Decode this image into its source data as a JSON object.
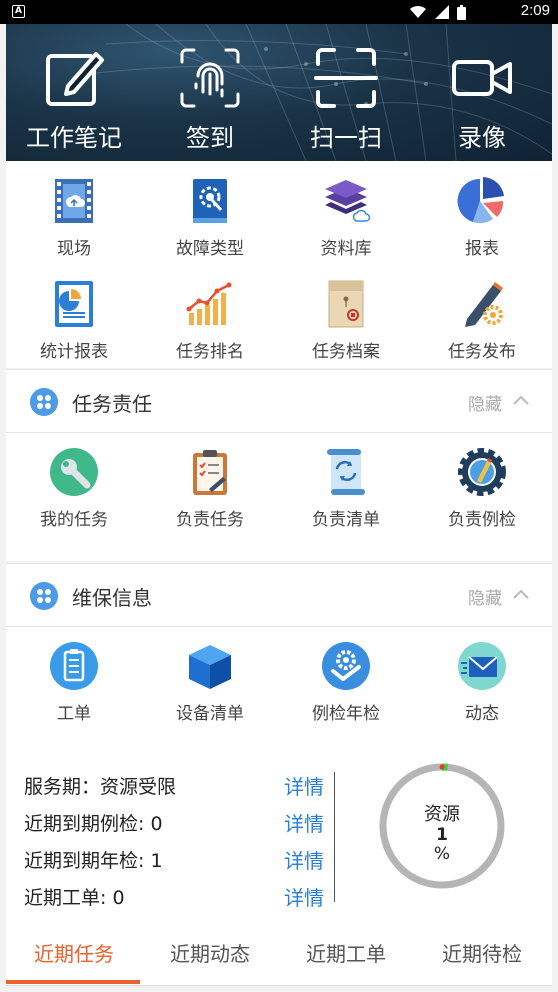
{
  "status_bar": {
    "time": "2:09",
    "app_indicator": "A"
  },
  "quick_actions": [
    {
      "label": "工作笔记",
      "icon": "edit-note-icon"
    },
    {
      "label": "签到",
      "icon": "fingerprint-icon"
    },
    {
      "label": "扫一扫",
      "icon": "scan-icon"
    },
    {
      "label": "录像",
      "icon": "video-camera-icon"
    }
  ],
  "main_grid": [
    {
      "label": "现场",
      "icon": "film-cloud-icon"
    },
    {
      "label": "故障类型",
      "icon": "gear-book-icon"
    },
    {
      "label": "资料库",
      "icon": "stacked-layers-icon"
    },
    {
      "label": "报表",
      "icon": "pie-chart-icon"
    },
    {
      "label": "统计报表",
      "icon": "stat-document-icon"
    },
    {
      "label": "任务排名",
      "icon": "bar-chart-icon"
    },
    {
      "label": "任务档案",
      "icon": "archive-folder-icon"
    },
    {
      "label": "任务发布",
      "icon": "pencil-gear-icon"
    }
  ],
  "sections": {
    "task": {
      "title": "任务责任",
      "toggle": "隐藏",
      "items": [
        {
          "label": "我的任务",
          "icon": "wrench-circle-icon"
        },
        {
          "label": "负责任务",
          "icon": "clipboard-icon"
        },
        {
          "label": "负责清单",
          "icon": "scroll-list-icon"
        },
        {
          "label": "负责例检",
          "icon": "gear-pencil-icon"
        }
      ]
    },
    "maint": {
      "title": "维保信息",
      "toggle": "隐藏",
      "items": [
        {
          "label": "工单",
          "icon": "checklist-icon"
        },
        {
          "label": "设备清单",
          "icon": "cube-icon"
        },
        {
          "label": "例检年检",
          "icon": "gear-check-icon"
        },
        {
          "label": "动态",
          "icon": "envelope-icon"
        }
      ]
    }
  },
  "info": {
    "rows": [
      {
        "text": "服务期：资源受限",
        "link": "详情"
      },
      {
        "text": "近期到期例检: 0",
        "link": "详情"
      },
      {
        "text": "近期到期年检: 1",
        "link": "详情"
      },
      {
        "text": "近期工单: 0",
        "link": "详情"
      }
    ],
    "gauge": {
      "label": "资源",
      "value": "1",
      "unit": "%",
      "percent": 1
    }
  },
  "bottom_tabs": [
    "近期任务",
    "近期动态",
    "近期工单",
    "近期待检"
  ],
  "colors": {
    "accent": "#e8622c",
    "link": "#2a7fd4",
    "section_icon": "#4c9be8"
  }
}
